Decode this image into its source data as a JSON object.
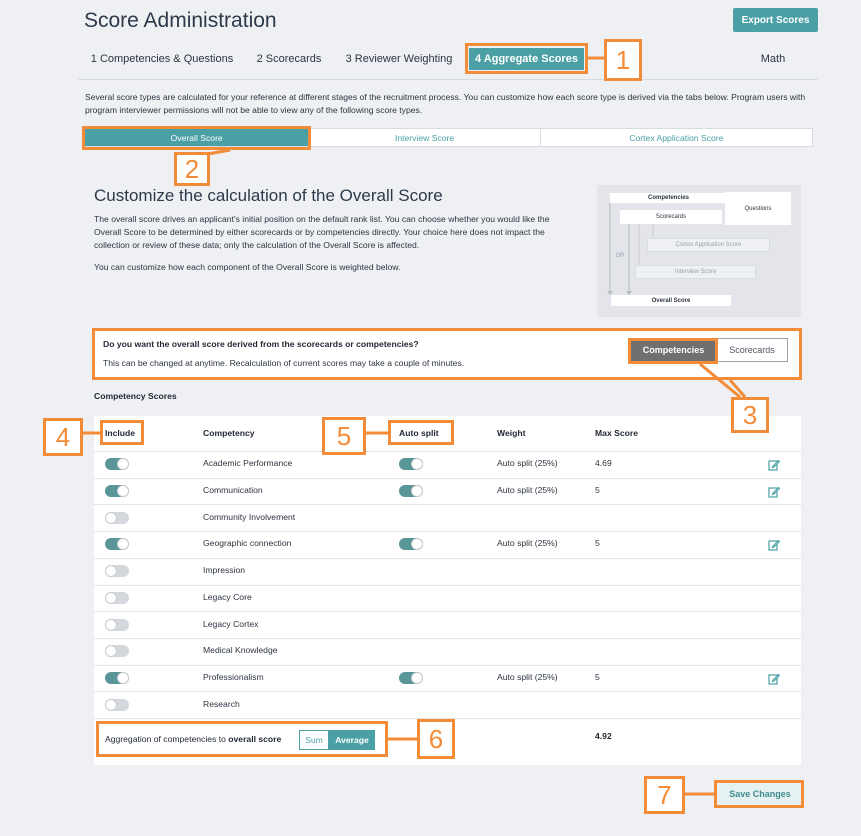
{
  "page_title": "Score Administration",
  "export_label": "Export Scores",
  "tabs": [
    {
      "label": "1 Competencies & Questions"
    },
    {
      "label": "2 Scorecards"
    },
    {
      "label": "3 Reviewer Weighting"
    },
    {
      "label": "4 Aggregate Scores"
    },
    {
      "label": "Math"
    }
  ],
  "intro_text": "Several score types are calculated for your reference at different stages of the recruitment process. You can customize how each score type is derived via the tabs below. Program users with program interviewer permissions will not be able to view any of the following score types.",
  "subtabs": [
    {
      "label": "Overall Score"
    },
    {
      "label": "Interview Score"
    },
    {
      "label": "Cortex Application Score"
    }
  ],
  "section_title": "Customize the calculation of the Overall Score",
  "section_desc": "The overall score drives an applicant's initial position on the default rank list. You can choose whether you would like the Overall Score to be determined by either scorecards or by competencies directly. Your choice here does not impact the collection or review of these data; only the calculation of the Overall Score is affected.",
  "section_desc2": "You can customize how each component of the Overall Score is weighted below.",
  "diagram": {
    "competencies": "Competencies",
    "questions": "Questions",
    "scorecards": "Scorecards",
    "cortex_app": "Cortex Application Score",
    "interview": "Interview Score",
    "or": "OR",
    "overall": "Overall Score"
  },
  "question": {
    "title": "Do you want the overall score derived from the scorecards or competencies?",
    "subtitle": "This can be changed at anytime. Recalculation of current scores may take a couple of minutes.",
    "option_competencies": "Competencies",
    "option_scorecards": "Scorecards"
  },
  "competency_scores_label": "Competency Scores",
  "table": {
    "headers": {
      "include": "Include",
      "competency": "Competency",
      "auto_split": "Auto split",
      "weight": "Weight",
      "max_score": "Max Score"
    },
    "rows": [
      {
        "name": "Academic Performance",
        "include": true,
        "auto": true,
        "weight": "Auto split (25%)",
        "max": "4.69"
      },
      {
        "name": "Communication",
        "include": true,
        "auto": true,
        "weight": "Auto split (25%)",
        "max": "5"
      },
      {
        "name": "Community Involvement",
        "include": false,
        "auto": false,
        "weight": "",
        "max": ""
      },
      {
        "name": "Geographic connection",
        "include": true,
        "auto": true,
        "weight": "Auto split (25%)",
        "max": "5"
      },
      {
        "name": "Impression",
        "include": false,
        "auto": false,
        "weight": "",
        "max": ""
      },
      {
        "name": "Legacy Core",
        "include": false,
        "auto": false,
        "weight": "",
        "max": ""
      },
      {
        "name": "Legacy Cortex",
        "include": false,
        "auto": false,
        "weight": "",
        "max": ""
      },
      {
        "name": "Medical Knowledge",
        "include": false,
        "auto": false,
        "weight": "",
        "max": ""
      },
      {
        "name": "Professionalism",
        "include": true,
        "auto": true,
        "weight": "Auto split (25%)",
        "max": "5"
      },
      {
        "name": "Research",
        "include": false,
        "auto": false,
        "weight": "",
        "max": ""
      }
    ]
  },
  "aggregation": {
    "label_prefix": "Aggregation of competencies to ",
    "label_bold": "overall score",
    "sum": "Sum",
    "average": "Average",
    "total": "4.92"
  },
  "save_label": "Save Changes",
  "annotations": [
    "1",
    "2",
    "3",
    "4",
    "5",
    "6",
    "7"
  ],
  "colors": {
    "accent": "#4aa0a4",
    "annotation": "#f28c38",
    "toggle_on": "#5a9598"
  }
}
